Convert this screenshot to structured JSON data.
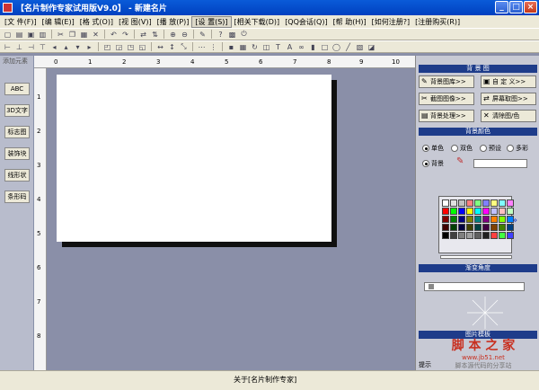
{
  "window": {
    "title": "【名片制作专家试用版V9.0】 - 新建名片",
    "min": "_",
    "max": "□",
    "close": "×"
  },
  "menu": [
    "[文 件(F)]",
    "[编 辑(E)]",
    "[格 式(O)]",
    "[视 图(V)]",
    "[播 放(P)]",
    "[设 置(S)]",
    "[相关下载(D)]",
    "[QQ会话(Q)]",
    "[帮 助(H)]",
    "[如何注册?]",
    "[注册购买(R)]"
  ],
  "left_panel": {
    "header": "添加元素",
    "tools": [
      "ABC",
      "3D文字",
      "标志图",
      "装饰块",
      "线形状",
      "条形码"
    ]
  },
  "ruler_h": [
    "0",
    "1",
    "2",
    "3",
    "4",
    "5",
    "6",
    "7",
    "8",
    "9",
    "10"
  ],
  "ruler_v": [
    "1",
    "2",
    "3",
    "4",
    "5",
    "6",
    "7",
    "8"
  ],
  "right_panel": {
    "bg_image_header": "背 景 图",
    "buttons": [
      "背景图库>>",
      "自 定 义>>",
      "截图图像>>",
      "屏幕取图>>",
      "背景处理>>",
      "清除图/色"
    ],
    "bg_color_header": "背景颜色",
    "color_modes": [
      "单色",
      "双色",
      "预设",
      "多彩"
    ],
    "bg_label": "背景",
    "gradient_header": "渐变角度",
    "extra_header": "图片模板",
    "extra_label": "提示"
  },
  "status": {
    "text": "关于[名片制作专家]"
  },
  "watermark": {
    "text": "脚 本 之 家",
    "url": "www.jb51.net",
    "sub": "脚本源代码的分享站"
  },
  "palette": [
    "#ffffff",
    "#e0e0e0",
    "#c0c0c0",
    "#ff8080",
    "#80ff80",
    "#8080ff",
    "#ffff80",
    "#80ffff",
    "#ff80ff",
    "#ff0000",
    "#00ff00",
    "#0000ff",
    "#ffff00",
    "#00ffff",
    "#ff00ff",
    "#c0c0ff",
    "#ffc0c0",
    "#c0ffc0",
    "#800000",
    "#008000",
    "#000080",
    "#808000",
    "#008080",
    "#800080",
    "#ff8000",
    "#80ff00",
    "#0080ff",
    "#400000",
    "#004000",
    "#000040",
    "#404000",
    "#004040",
    "#400040",
    "#804000",
    "#408000",
    "#004080",
    "#000000",
    "#404040",
    "#808080",
    "#a0a0a0",
    "#606060",
    "#202020",
    "#ff4040",
    "#40ff40",
    "#4040ff"
  ]
}
